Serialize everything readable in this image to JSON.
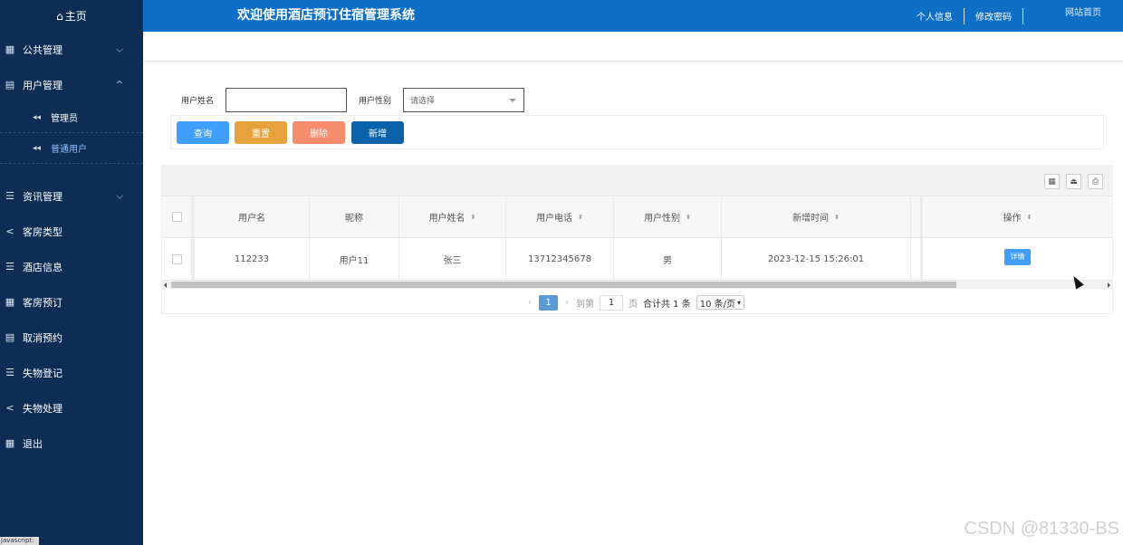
{
  "sidebar": {
    "home": "主页",
    "items": [
      {
        "label": "公共管理",
        "chevron": "chevron-down"
      },
      {
        "label": "用户管理",
        "chevron": "chevron-up"
      },
      {
        "label": "资讯管理",
        "chevron": "chevron-down"
      },
      {
        "label": "客房类型"
      },
      {
        "label": "酒店信息"
      },
      {
        "label": "客房预订"
      },
      {
        "label": "取消预约"
      },
      {
        "label": "失物登记"
      },
      {
        "label": "失物处理"
      },
      {
        "label": "退出"
      }
    ],
    "sub_items": [
      {
        "label": "管理员"
      },
      {
        "label": "普通用户"
      }
    ],
    "js_status": "javascript:"
  },
  "header": {
    "title": "欢迎使用酒店预订住宿管理系统",
    "profile": "个人信息",
    "change_password": "修改密码",
    "site_home": "网站首页"
  },
  "search": {
    "name_label": "用户姓名",
    "name_value": "",
    "gender_label": "用户性别",
    "gender_placeholder": "请选择"
  },
  "buttons": {
    "query": "查询",
    "reset": "重置",
    "delete": "删除",
    "add": "新增"
  },
  "table": {
    "columns": [
      "用户名",
      "昵称",
      "用户姓名",
      "用户电话",
      "用户性别",
      "新增时间",
      "操作"
    ],
    "rows": [
      {
        "username": "112233",
        "nickname": "用户11",
        "name": "张三",
        "phone": "13712345678",
        "gender": "男",
        "created": "2023-12-15 15:26:01",
        "action": "详情"
      }
    ]
  },
  "pager": {
    "current": "1",
    "goto_label": "到第",
    "goto_value": "1",
    "page_unit": "页",
    "total": "合计共 1 条",
    "page_size": "10 条/页"
  },
  "watermark": "CSDN @81330-BS"
}
